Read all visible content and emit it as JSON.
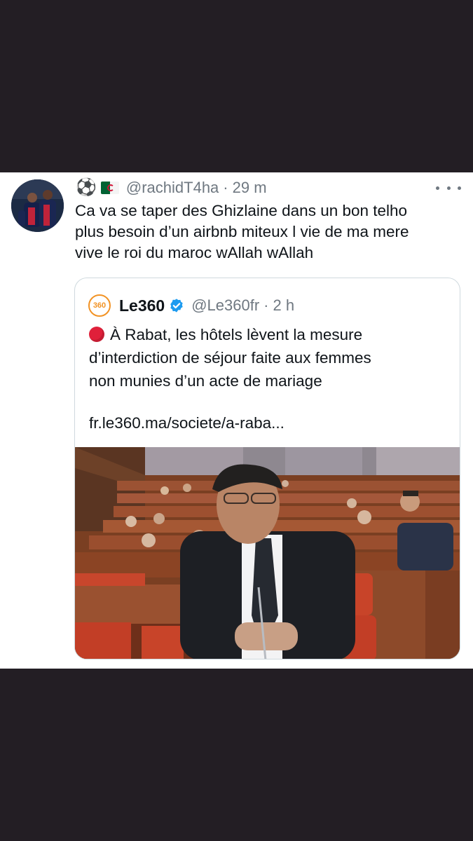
{
  "tweet": {
    "emoji_ball": "⚽",
    "flag_icon": "algeria-flag-icon",
    "handle": "@rachidT4ha",
    "separator": "·",
    "time": "29 m",
    "lines": [
      "Ca va se taper des Ghizlaine dans un bon telho",
      "plus besoin d’un airbnb miteux l vie de ma mere",
      "vive le roi du maroc wAllah wAllah"
    ]
  },
  "quote": {
    "logo_text": "360",
    "name": "Le360",
    "handle": "@Le360fr",
    "separator": "·",
    "time": "2 h",
    "lines": [
      "À Rabat, les hôtels lèvent la mesure",
      "d’interdiction de séjour faite aux femmes",
      "non munies d’un acte de mariage"
    ],
    "link": "fr.le360.ma/societe/a-raba..."
  },
  "colors": {
    "background": "#231e24",
    "card": "#ffffff",
    "text": "#0f1419",
    "muted": "#6f7881",
    "verified": "#1d9bf0",
    "brand_orange": "#f29325"
  }
}
